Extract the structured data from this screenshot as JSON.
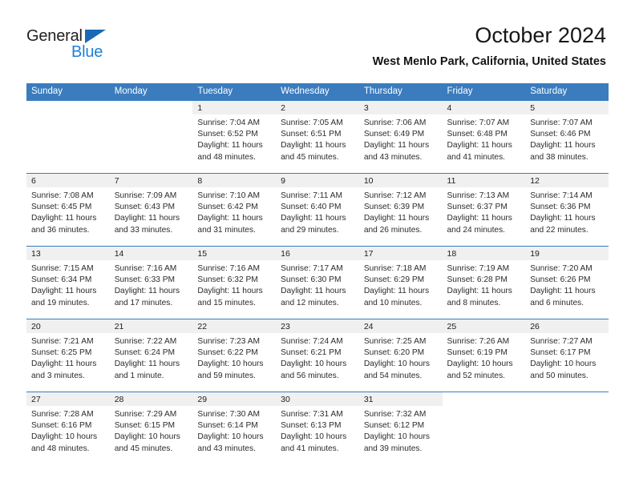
{
  "logo": {
    "word_general": "General",
    "word_blue": "Blue",
    "triangle_color": "#1b69b4",
    "blue_text_color": "#1f7fd4"
  },
  "header": {
    "title": "October 2024",
    "subtitle": "West Menlo Park, California, United States"
  },
  "theme": {
    "header_bg": "#3a7cbe",
    "daynum_band_bg": "#f0f0f0",
    "week_divider": "#3a7cbe",
    "text": "#2b2b2b"
  },
  "weekday_headers": [
    "Sunday",
    "Monday",
    "Tuesday",
    "Wednesday",
    "Thursday",
    "Friday",
    "Saturday"
  ],
  "labels": {
    "sunrise_prefix": "Sunrise:",
    "sunset_prefix": "Sunset:",
    "daylight_prefix": "Daylight:"
  },
  "weeks": [
    [
      {
        "day": "",
        "empty": true
      },
      {
        "day": "",
        "empty": true
      },
      {
        "day": "1",
        "sunrise": "Sunrise: 7:04 AM",
        "sunset": "Sunset: 6:52 PM",
        "daylight1": "Daylight: 11 hours",
        "daylight2": "and 48 minutes."
      },
      {
        "day": "2",
        "sunrise": "Sunrise: 7:05 AM",
        "sunset": "Sunset: 6:51 PM",
        "daylight1": "Daylight: 11 hours",
        "daylight2": "and 45 minutes."
      },
      {
        "day": "3",
        "sunrise": "Sunrise: 7:06 AM",
        "sunset": "Sunset: 6:49 PM",
        "daylight1": "Daylight: 11 hours",
        "daylight2": "and 43 minutes."
      },
      {
        "day": "4",
        "sunrise": "Sunrise: 7:07 AM",
        "sunset": "Sunset: 6:48 PM",
        "daylight1": "Daylight: 11 hours",
        "daylight2": "and 41 minutes."
      },
      {
        "day": "5",
        "sunrise": "Sunrise: 7:07 AM",
        "sunset": "Sunset: 6:46 PM",
        "daylight1": "Daylight: 11 hours",
        "daylight2": "and 38 minutes."
      }
    ],
    [
      {
        "day": "6",
        "sunrise": "Sunrise: 7:08 AM",
        "sunset": "Sunset: 6:45 PM",
        "daylight1": "Daylight: 11 hours",
        "daylight2": "and 36 minutes."
      },
      {
        "day": "7",
        "sunrise": "Sunrise: 7:09 AM",
        "sunset": "Sunset: 6:43 PM",
        "daylight1": "Daylight: 11 hours",
        "daylight2": "and 33 minutes."
      },
      {
        "day": "8",
        "sunrise": "Sunrise: 7:10 AM",
        "sunset": "Sunset: 6:42 PM",
        "daylight1": "Daylight: 11 hours",
        "daylight2": "and 31 minutes."
      },
      {
        "day": "9",
        "sunrise": "Sunrise: 7:11 AM",
        "sunset": "Sunset: 6:40 PM",
        "daylight1": "Daylight: 11 hours",
        "daylight2": "and 29 minutes."
      },
      {
        "day": "10",
        "sunrise": "Sunrise: 7:12 AM",
        "sunset": "Sunset: 6:39 PM",
        "daylight1": "Daylight: 11 hours",
        "daylight2": "and 26 minutes."
      },
      {
        "day": "11",
        "sunrise": "Sunrise: 7:13 AM",
        "sunset": "Sunset: 6:37 PM",
        "daylight1": "Daylight: 11 hours",
        "daylight2": "and 24 minutes."
      },
      {
        "day": "12",
        "sunrise": "Sunrise: 7:14 AM",
        "sunset": "Sunset: 6:36 PM",
        "daylight1": "Daylight: 11 hours",
        "daylight2": "and 22 minutes."
      }
    ],
    [
      {
        "day": "13",
        "sunrise": "Sunrise: 7:15 AM",
        "sunset": "Sunset: 6:34 PM",
        "daylight1": "Daylight: 11 hours",
        "daylight2": "and 19 minutes."
      },
      {
        "day": "14",
        "sunrise": "Sunrise: 7:16 AM",
        "sunset": "Sunset: 6:33 PM",
        "daylight1": "Daylight: 11 hours",
        "daylight2": "and 17 minutes."
      },
      {
        "day": "15",
        "sunrise": "Sunrise: 7:16 AM",
        "sunset": "Sunset: 6:32 PM",
        "daylight1": "Daylight: 11 hours",
        "daylight2": "and 15 minutes."
      },
      {
        "day": "16",
        "sunrise": "Sunrise: 7:17 AM",
        "sunset": "Sunset: 6:30 PM",
        "daylight1": "Daylight: 11 hours",
        "daylight2": "and 12 minutes."
      },
      {
        "day": "17",
        "sunrise": "Sunrise: 7:18 AM",
        "sunset": "Sunset: 6:29 PM",
        "daylight1": "Daylight: 11 hours",
        "daylight2": "and 10 minutes."
      },
      {
        "day": "18",
        "sunrise": "Sunrise: 7:19 AM",
        "sunset": "Sunset: 6:28 PM",
        "daylight1": "Daylight: 11 hours",
        "daylight2": "and 8 minutes."
      },
      {
        "day": "19",
        "sunrise": "Sunrise: 7:20 AM",
        "sunset": "Sunset: 6:26 PM",
        "daylight1": "Daylight: 11 hours",
        "daylight2": "and 6 minutes."
      }
    ],
    [
      {
        "day": "20",
        "sunrise": "Sunrise: 7:21 AM",
        "sunset": "Sunset: 6:25 PM",
        "daylight1": "Daylight: 11 hours",
        "daylight2": "and 3 minutes."
      },
      {
        "day": "21",
        "sunrise": "Sunrise: 7:22 AM",
        "sunset": "Sunset: 6:24 PM",
        "daylight1": "Daylight: 11 hours",
        "daylight2": "and 1 minute."
      },
      {
        "day": "22",
        "sunrise": "Sunrise: 7:23 AM",
        "sunset": "Sunset: 6:22 PM",
        "daylight1": "Daylight: 10 hours",
        "daylight2": "and 59 minutes."
      },
      {
        "day": "23",
        "sunrise": "Sunrise: 7:24 AM",
        "sunset": "Sunset: 6:21 PM",
        "daylight1": "Daylight: 10 hours",
        "daylight2": "and 56 minutes."
      },
      {
        "day": "24",
        "sunrise": "Sunrise: 7:25 AM",
        "sunset": "Sunset: 6:20 PM",
        "daylight1": "Daylight: 10 hours",
        "daylight2": "and 54 minutes."
      },
      {
        "day": "25",
        "sunrise": "Sunrise: 7:26 AM",
        "sunset": "Sunset: 6:19 PM",
        "daylight1": "Daylight: 10 hours",
        "daylight2": "and 52 minutes."
      },
      {
        "day": "26",
        "sunrise": "Sunrise: 7:27 AM",
        "sunset": "Sunset: 6:17 PM",
        "daylight1": "Daylight: 10 hours",
        "daylight2": "and 50 minutes."
      }
    ],
    [
      {
        "day": "27",
        "sunrise": "Sunrise: 7:28 AM",
        "sunset": "Sunset: 6:16 PM",
        "daylight1": "Daylight: 10 hours",
        "daylight2": "and 48 minutes."
      },
      {
        "day": "28",
        "sunrise": "Sunrise: 7:29 AM",
        "sunset": "Sunset: 6:15 PM",
        "daylight1": "Daylight: 10 hours",
        "daylight2": "and 45 minutes."
      },
      {
        "day": "29",
        "sunrise": "Sunrise: 7:30 AM",
        "sunset": "Sunset: 6:14 PM",
        "daylight1": "Daylight: 10 hours",
        "daylight2": "and 43 minutes."
      },
      {
        "day": "30",
        "sunrise": "Sunrise: 7:31 AM",
        "sunset": "Sunset: 6:13 PM",
        "daylight1": "Daylight: 10 hours",
        "daylight2": "and 41 minutes."
      },
      {
        "day": "31",
        "sunrise": "Sunrise: 7:32 AM",
        "sunset": "Sunset: 6:12 PM",
        "daylight1": "Daylight: 10 hours",
        "daylight2": "and 39 minutes."
      },
      {
        "day": "",
        "empty": true
      },
      {
        "day": "",
        "empty": true
      }
    ]
  ]
}
